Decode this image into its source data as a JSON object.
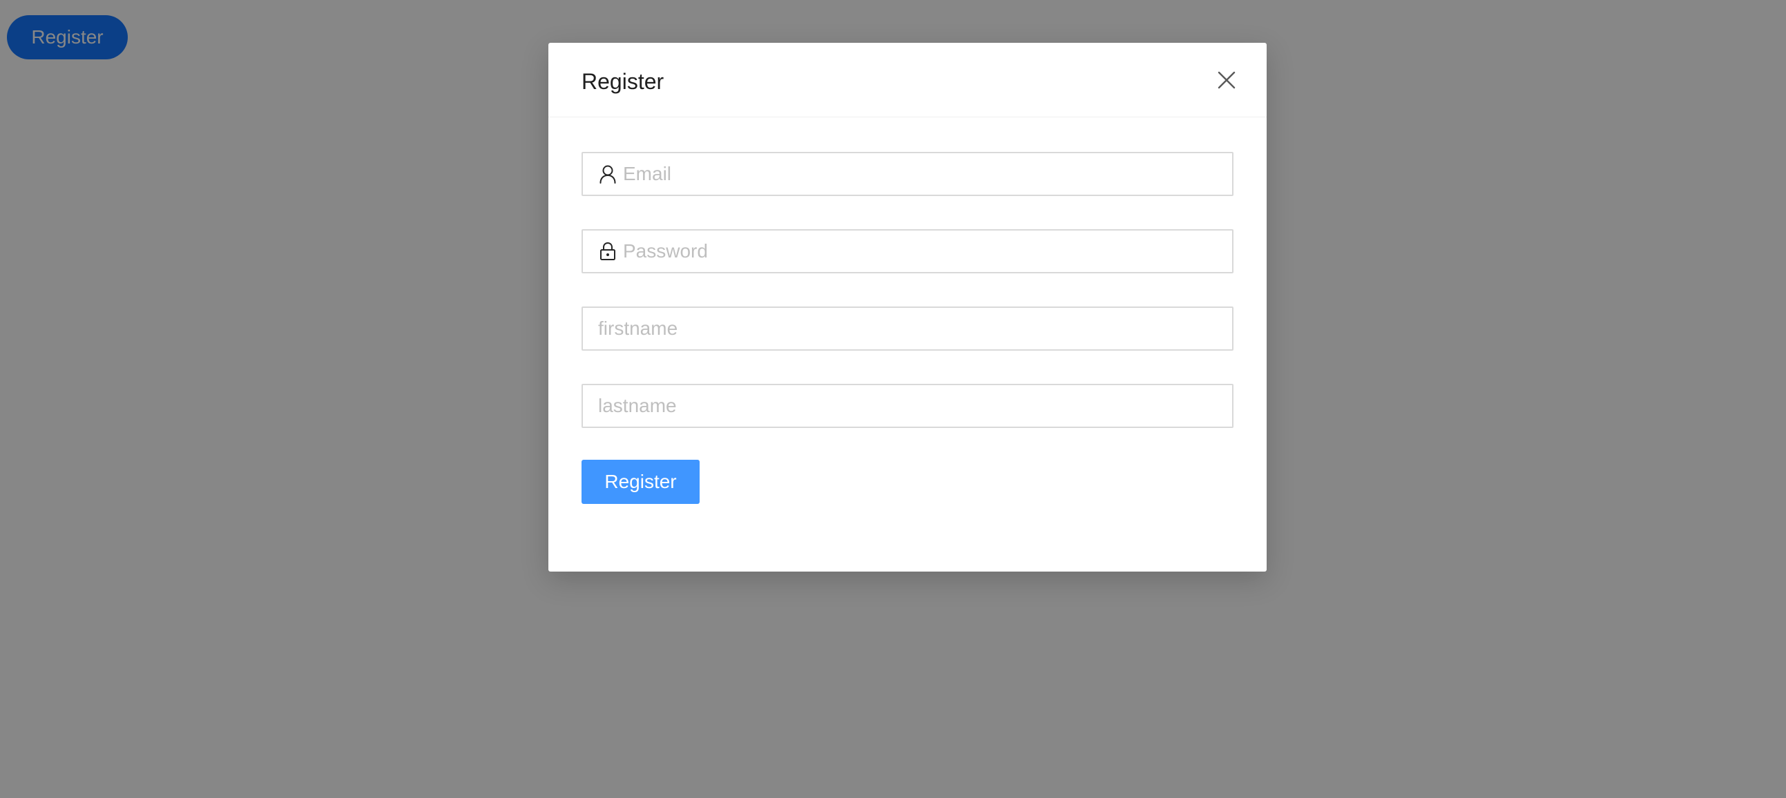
{
  "page": {
    "open_button_label": "Register"
  },
  "modal": {
    "title": "Register",
    "fields": {
      "email": {
        "placeholder": "Email",
        "value": "",
        "icon": "user-icon"
      },
      "password": {
        "placeholder": "Password",
        "value": "",
        "icon": "lock-icon"
      },
      "firstname": {
        "placeholder": "firstname",
        "value": ""
      },
      "lastname": {
        "placeholder": "lastname",
        "value": ""
      }
    },
    "submit_label": "Register"
  },
  "colors": {
    "primary": "#1677ff",
    "primary_hover": "#4096ff",
    "mask": "rgba(0,0,0,0.47)",
    "border": "#d9d9d9",
    "placeholder": "#bfbfbf"
  }
}
